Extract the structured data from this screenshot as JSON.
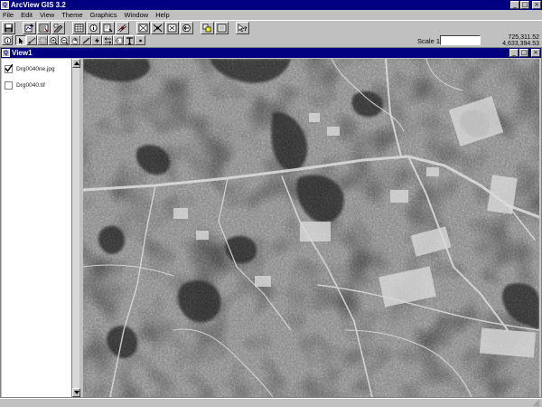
{
  "app": {
    "title": "ArcView GIS 3.2",
    "icon_glyph": "Q"
  },
  "window_controls": {
    "minimize": "_",
    "maximize": "□",
    "close": "×"
  },
  "menu": [
    "File",
    "Edit",
    "View",
    "Theme",
    "Graphics",
    "Window",
    "Help"
  ],
  "toolbar": {
    "buttons": [
      "save-icon",
      "add-theme-icon",
      "theme-properties-icon",
      "edit-legend-icon",
      "open-attributes-icon",
      "identify-info-icon",
      "query-builder-icon",
      "locate-address-icon",
      "zoom-full-icon",
      "zoom-active-themes-icon",
      "zoom-selected-icon",
      "zoom-previous-icon",
      "select-by-theme-icon",
      "clear-selection-icon",
      "help-cursor-icon"
    ]
  },
  "tools": {
    "buttons": [
      "identify-tool-icon",
      "pointer-tool-icon",
      "vertex-edit-icon",
      "select-feature-icon",
      "zoom-in-tool-icon",
      "zoom-out-tool-icon",
      "pan-hand-icon",
      "measure-tool-icon",
      "hotlink-icon",
      "area-of-interest-icon",
      "label-tool-icon",
      "text-tool-icon",
      "draw-point-icon"
    ],
    "scale_label": "Scale 1:",
    "scale_value": "",
    "coord_x": "725,311.52",
    "coord_y": "4,633,394.53"
  },
  "view": {
    "title": "View1",
    "themes": [
      {
        "label": "Drg0040ne.jpg",
        "checked": true
      },
      {
        "label": "Drg0040.tif",
        "checked": false
      }
    ]
  },
  "colors": {
    "title_bar": "#000080",
    "chrome": "#c0c0c0"
  }
}
